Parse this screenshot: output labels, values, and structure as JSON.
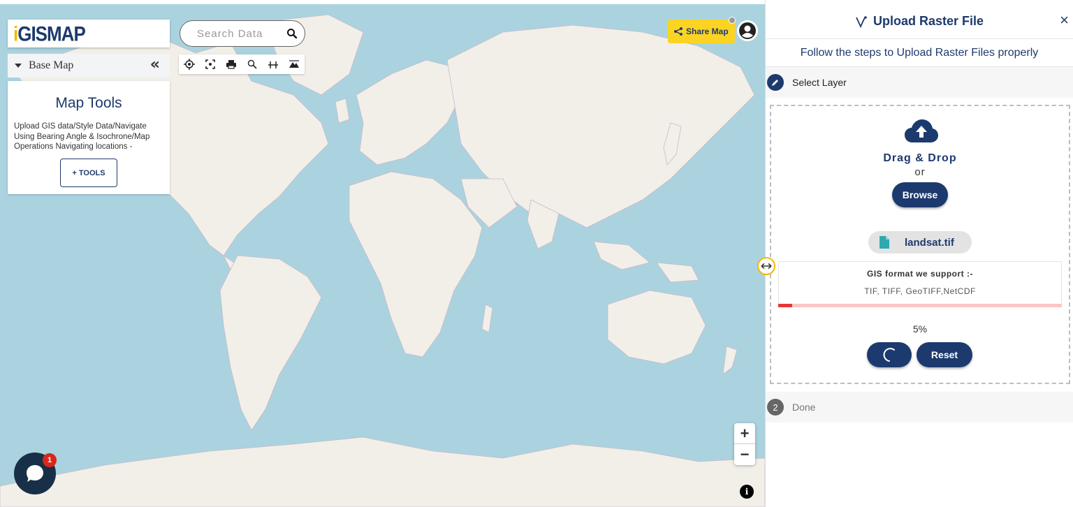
{
  "logo": {
    "mark": "i",
    "text": "GISMAP"
  },
  "sidebar": {
    "basemap_label": "Base Map",
    "collapse_glyph": "«",
    "tools_title": "Map Tools",
    "tools_desc": "Upload GIS data/Style Data/Navigate Using Bearing Angle & Isochrone/Map Operations Navigating locations -",
    "tools_button": "+ TOOLS"
  },
  "search": {
    "placeholder": "Search Data"
  },
  "toolbar": {
    "icons": [
      "locate-icon",
      "fullscreen-icon",
      "print-icon",
      "zoom-search-icon",
      "measure-icon",
      "elevation-icon"
    ]
  },
  "header": {
    "share_label": "Share Map"
  },
  "map_controls": {
    "zoom_in": "+",
    "zoom_out": "−",
    "info": "i"
  },
  "chat": {
    "badge_count": "1"
  },
  "panel": {
    "title": "Upload Raster File",
    "close": "×",
    "hint": "Follow the steps to Upload Raster Files properly",
    "step1": {
      "label": "Select Layer"
    },
    "step2": {
      "number": "2",
      "label": "Done"
    },
    "dropzone": {
      "drag_text": "Drag & Drop",
      "or_text": "or",
      "browse_label": "Browse",
      "file_name": "landsat.tif",
      "formats_title": "GIS format we support :-",
      "formats_list": "TIF, TIFF, GeoTIFF,NetCDF",
      "progress_percent": 5,
      "progress_text": "5%",
      "reset_label": "Reset"
    }
  },
  "colors": {
    "brand_navy": "#1d3a6e",
    "accent_yellow": "#fbd323",
    "ocean": "#aad3df",
    "land": "#f2efe9",
    "progress": "#e53935"
  }
}
